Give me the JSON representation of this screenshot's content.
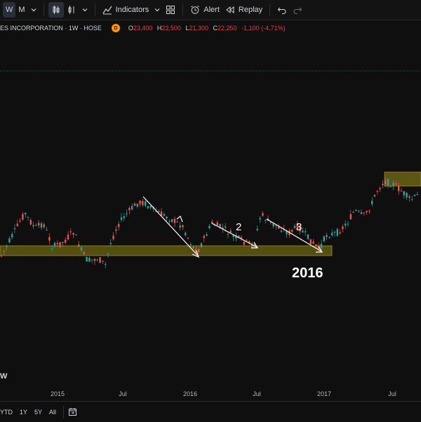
{
  "toolbar": {
    "interval_w": "W",
    "interval_m": "M",
    "indicators_label": "Indicators",
    "alert_label": "Alert",
    "replay_label": "Replay"
  },
  "legend": {
    "symbol": "ES INCORPORATION · 1W · HOSE",
    "badge": "D",
    "open_key": "O",
    "open_val": "23,400",
    "high_key": "H",
    "high_val": "23,500",
    "low_key": "L",
    "low_val": "21,300",
    "close_key": "C",
    "close_val": "22,250",
    "change": "-1,100 (-4.71%)"
  },
  "annotations": {
    "label_2": "2",
    "label_3": "3",
    "year_label": "2016",
    "pane_label": "W"
  },
  "xaxis": {
    "ticks": [
      "2015",
      "Jul",
      "2016",
      "Jul",
      "2017",
      "Jul"
    ]
  },
  "bottom_bar": {
    "ytd": "YTD",
    "y1": "1Y",
    "y5": "5Y",
    "all": "All"
  },
  "colors": {
    "up": "#26a69a",
    "down": "#ef5350",
    "zone": "#5f5a12",
    "zone_border": "#c9a227",
    "trendline": "#ffffff",
    "hline": "#1e8f3e"
  }
}
